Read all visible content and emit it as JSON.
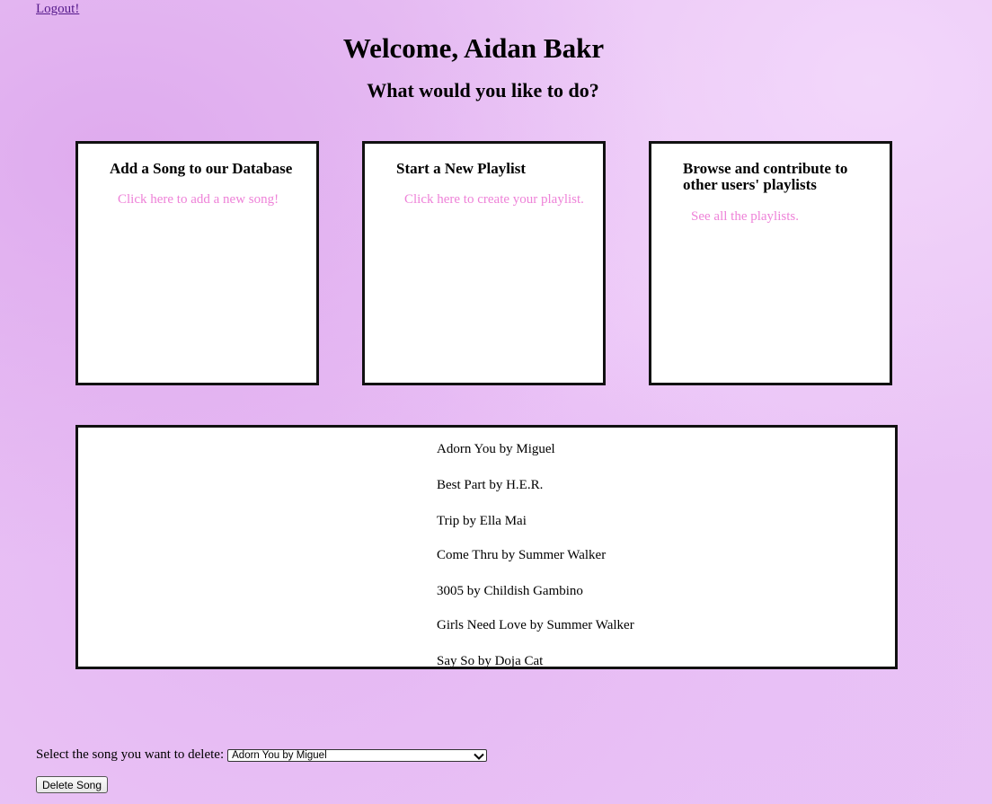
{
  "header": {
    "logout_label": "Logout!",
    "welcome_title": "Welcome, Aidan Bakr",
    "question": "What would you like to do?"
  },
  "cards": [
    {
      "title": "Add a Song to our Database",
      "link": "Click here to add a new song!"
    },
    {
      "title": "Start a New Playlist",
      "link": "Click here to create your playlist."
    },
    {
      "title": "Browse and contribute to other users' playlists",
      "link": "See all the playlists."
    }
  ],
  "songs": [
    "Adorn You by Miguel",
    "Best Part by H.E.R.",
    "Trip by Ella Mai",
    "Come Thru by Summer Walker",
    "3005 by Childish Gambino",
    "Girls Need Love by Summer Walker",
    "Say So by Doja Cat"
  ],
  "delete_form": {
    "label": "Select the song you want to delete:",
    "selected_value": "Adorn You by Miguel",
    "button_label": "Delete Song"
  },
  "colors": {
    "link_pink": "#ee82d8",
    "logout_link": "#551a8b",
    "background": "#e9c3f5"
  },
  "icons": {
    "dropdown": "chevron-down-icon"
  }
}
